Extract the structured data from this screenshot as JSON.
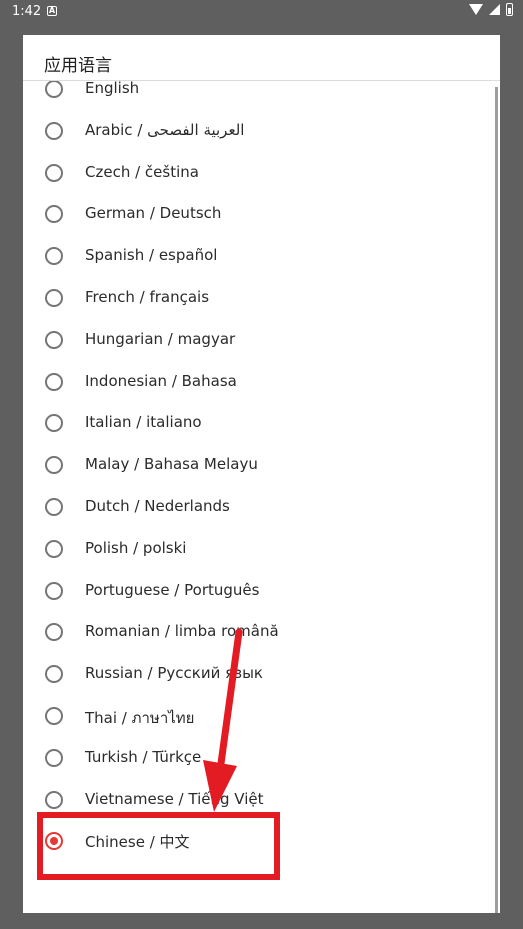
{
  "status": {
    "time": "1:42",
    "notif_glyph": "A"
  },
  "dialog": {
    "title": "应用语言",
    "items": [
      {
        "label": "English",
        "checked": false
      },
      {
        "label": "Arabic / العربية الفصحى",
        "checked": false
      },
      {
        "label": "Czech / čeština",
        "checked": false
      },
      {
        "label": "German / Deutsch",
        "checked": false
      },
      {
        "label": "Spanish / español",
        "checked": false
      },
      {
        "label": "French / français",
        "checked": false
      },
      {
        "label": "Hungarian / magyar",
        "checked": false
      },
      {
        "label": "Indonesian / Bahasa",
        "checked": false
      },
      {
        "label": "Italian / italiano",
        "checked": false
      },
      {
        "label": "Malay / Bahasa Melayu",
        "checked": false
      },
      {
        "label": "Dutch / Nederlands",
        "checked": false
      },
      {
        "label": "Polish / polski",
        "checked": false
      },
      {
        "label": "Portuguese / Português",
        "checked": false
      },
      {
        "label": "Romanian / limba română",
        "checked": false
      },
      {
        "label": "Russian / Русский язык",
        "checked": false
      },
      {
        "label": "Thai / ภาษาไทย",
        "checked": false
      },
      {
        "label": "Turkish / Türkçe",
        "checked": false
      },
      {
        "label": "Vietnamese / Tiếng Việt",
        "checked": false
      },
      {
        "label": "Chinese / 中文",
        "checked": true
      }
    ]
  },
  "annotation": {
    "color": "#e31b23"
  },
  "colors": {
    "accent": "#e53935",
    "scrim": "#5f5f5f"
  }
}
